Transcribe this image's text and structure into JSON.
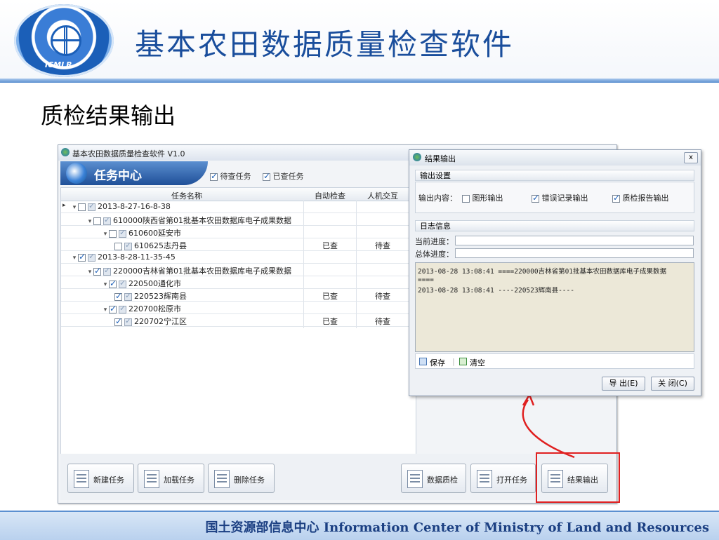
{
  "header": {
    "app_title": "基本农田数据质量检查软件",
    "logo_text": "ICMLR"
  },
  "slide_title": "质检结果输出",
  "footer": {
    "text": "国土资源部信息中心  Information Center of Ministry of Land and Resources"
  },
  "main_window": {
    "title": "基本农田数据质量检查软件 V1.0",
    "task_center": "任务中心",
    "filters": [
      {
        "label": "待查任务",
        "checked": true
      },
      {
        "label": "已查任务",
        "checked": true
      }
    ],
    "columns": [
      "任务名称",
      "自动检查",
      "人机交互"
    ],
    "rows": [
      {
        "name": "2013-8-27-16-8-38",
        "auto": "",
        "manual": "",
        "level": 0,
        "checked": false
      },
      {
        "name": "610000陕西省第01批基本农田数据库电子成果数据",
        "auto": "",
        "manual": "",
        "level": 1,
        "checked": false
      },
      {
        "name": "610600延安市",
        "auto": "",
        "manual": "",
        "level": 2,
        "checked": false
      },
      {
        "name": "610625志丹县",
        "auto": "已查",
        "manual": "待查",
        "level": 3,
        "checked": false
      },
      {
        "name": "2013-8-28-11-35-45",
        "auto": "",
        "manual": "",
        "level": 0,
        "checked": true
      },
      {
        "name": "220000吉林省第01批基本农田数据库电子成果数据",
        "auto": "",
        "manual": "",
        "level": 1,
        "checked": true
      },
      {
        "name": "220500通化市",
        "auto": "",
        "manual": "",
        "level": 2,
        "checked": true
      },
      {
        "name": "220523辉南县",
        "auto": "已查",
        "manual": "待查",
        "level": 3,
        "checked": true
      },
      {
        "name": "220700松原市",
        "auto": "",
        "manual": "",
        "level": 2,
        "checked": true
      },
      {
        "name": "220702宁江区",
        "auto": "已查",
        "manual": "待查",
        "level": 3,
        "checked": true
      }
    ],
    "buttons": {
      "new_task": "新建任务",
      "load_task": "加载任务",
      "delete_task": "删除任务",
      "data_check": "数据质检",
      "open_task": "打开任务",
      "result_output": "结果输出"
    }
  },
  "dialog": {
    "title": "结果输出",
    "close": "x",
    "output_settings": "输出设置",
    "output_content_label": "输出内容：",
    "options": [
      {
        "label": "图形输出",
        "checked": false
      },
      {
        "label": "错误记录输出",
        "checked": true
      },
      {
        "label": "质检报告输出",
        "checked": true
      }
    ],
    "log_info": "日志信息",
    "current_progress": "当前进度：",
    "total_progress": "总体进度：",
    "log_lines": [
      "2013-08-28 13:08:41  ====220000吉林省第01批基本农田数据库电子成果数据",
      "====",
      "2013-08-28 13:08:41  ----220523辉南县----"
    ],
    "save": "保存",
    "clear": "清空",
    "export": "导 出(E)",
    "close_btn": "关 闭(C)"
  },
  "colors": {
    "title_blue": "#1a4e9c",
    "highlight_red": "#e02020"
  }
}
